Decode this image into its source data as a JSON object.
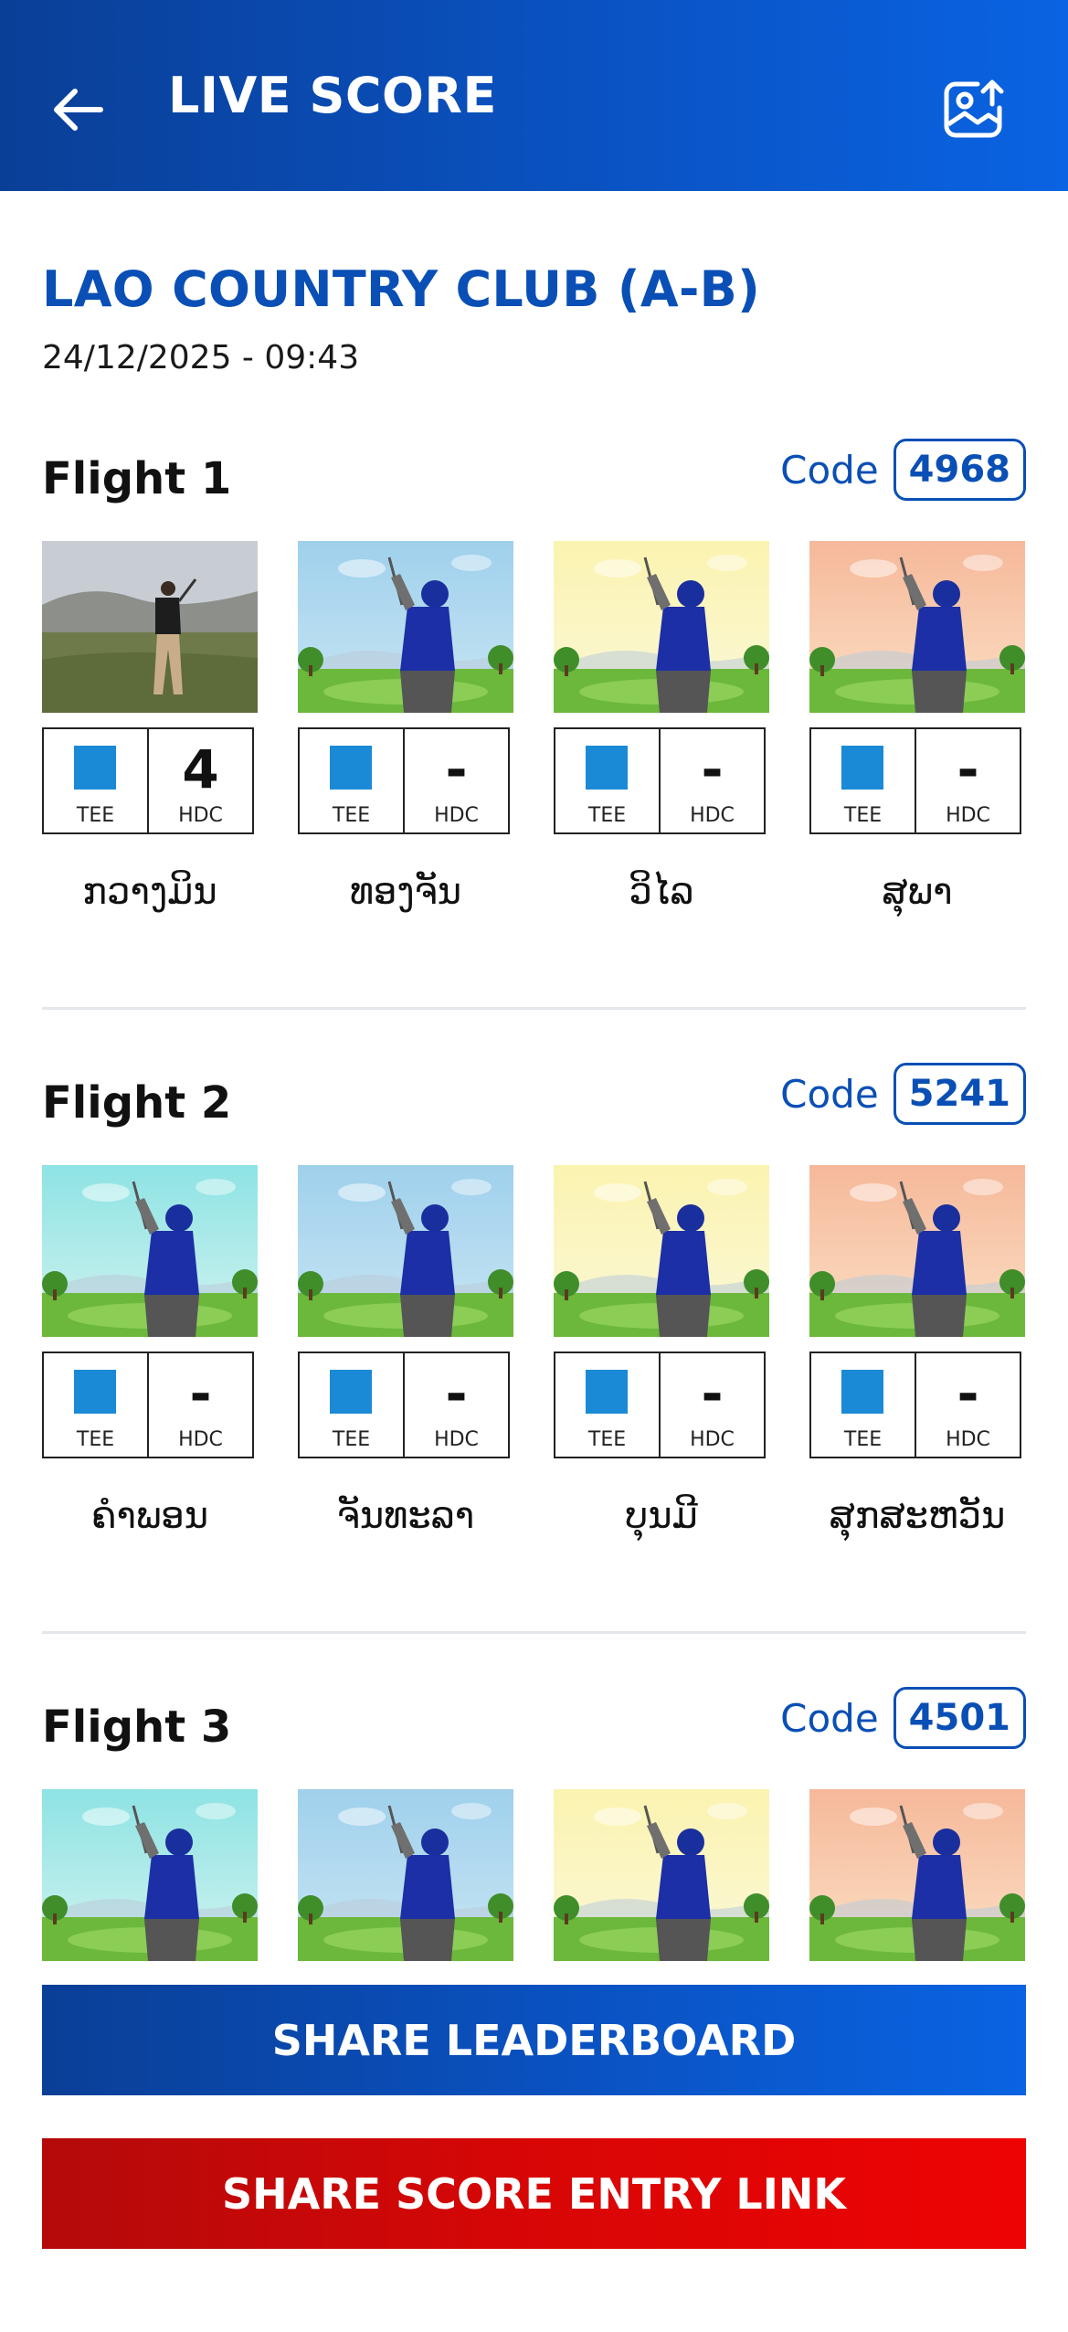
{
  "header": {
    "title": "LIVE SCORE",
    "back_icon": "arrow-left-icon",
    "share_image_icon": "image-share-icon"
  },
  "club": {
    "name": "LAO COUNTRY CLUB (A-B)",
    "datetime": "24/12/2025 - 09:43"
  },
  "flights": [
    {
      "title": "Flight 1",
      "code_label": "Code",
      "code": "4968",
      "players": [
        {
          "name": "ກວາງມິນ",
          "hdc": "4",
          "tee_label": "TEE",
          "hdc_label": "HDC",
          "tee_color": "#1a8ad6",
          "photo": "real-golfer"
        },
        {
          "name": "ທອງຈັນ",
          "hdc": "-",
          "tee_label": "TEE",
          "hdc_label": "HDC",
          "tee_color": "#1a8ad6",
          "photo": "blue"
        },
        {
          "name": "ວິໄລ",
          "hdc": "-",
          "tee_label": "TEE",
          "hdc_label": "HDC",
          "tee_color": "#1a8ad6",
          "photo": "yellow"
        },
        {
          "name": "ສຸພາ",
          "hdc": "-",
          "tee_label": "TEE",
          "hdc_label": "HDC",
          "tee_color": "#1a8ad6",
          "photo": "orange"
        }
      ]
    },
    {
      "title": "Flight 2",
      "code_label": "Code",
      "code": "5241",
      "players": [
        {
          "name": "ຄຳພອນ",
          "hdc": "-",
          "tee_label": "TEE",
          "hdc_label": "HDC",
          "tee_color": "#1a8ad6",
          "photo": "teal"
        },
        {
          "name": "ຈັນທະລາ",
          "hdc": "-",
          "tee_label": "TEE",
          "hdc_label": "HDC",
          "tee_color": "#1a8ad6",
          "photo": "blue"
        },
        {
          "name": "ບຸນມີ",
          "hdc": "-",
          "tee_label": "TEE",
          "hdc_label": "HDC",
          "tee_color": "#1a8ad6",
          "photo": "yellow"
        },
        {
          "name": "ສຸກສະຫວັນ",
          "hdc": "-",
          "tee_label": "TEE",
          "hdc_label": "HDC",
          "tee_color": "#1a8ad6",
          "photo": "orange"
        }
      ]
    },
    {
      "title": "Flight 3",
      "code_label": "Code",
      "code": "4501",
      "players": [
        {
          "name": "",
          "hdc": "",
          "tee_label": "",
          "hdc_label": "",
          "tee_color": "#1a8ad6",
          "photo": "teal"
        },
        {
          "name": "",
          "hdc": "",
          "tee_label": "",
          "hdc_label": "",
          "tee_color": "#1a8ad6",
          "photo": "blue"
        },
        {
          "name": "",
          "hdc": "",
          "tee_label": "",
          "hdc_label": "",
          "tee_color": "#1a8ad6",
          "photo": "yellow"
        },
        {
          "name": "",
          "hdc": "",
          "tee_label": "",
          "hdc_label": "",
          "tee_color": "#1a8ad6",
          "photo": "orange"
        }
      ]
    }
  ],
  "buttons": {
    "share_leaderboard": "SHARE LEADERBOARD",
    "share_score_entry": "SHARE SCORE ENTRY LINK"
  },
  "colors": {
    "primary": "#0a4fb5",
    "danger": "#d80606",
    "tee_blue": "#1a8ad6"
  }
}
